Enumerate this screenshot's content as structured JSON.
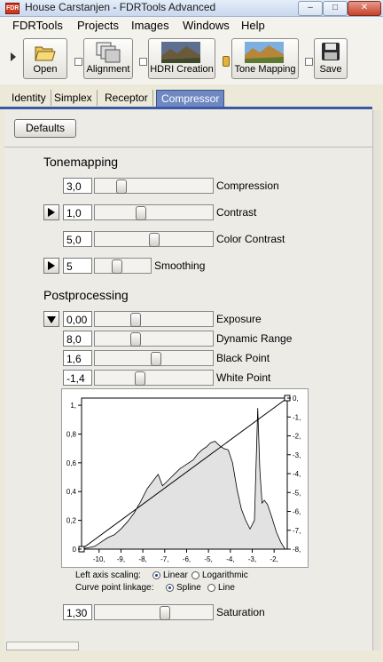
{
  "window": {
    "title": "House Carstanjen - FDRTools Advanced",
    "minimize_label": "–",
    "maximize_label": "□",
    "close_label": "✕",
    "icon_text": "FDR"
  },
  "menu": [
    {
      "label": "FDRTools"
    },
    {
      "label": "Projects"
    },
    {
      "label": "Images"
    },
    {
      "label": "Windows"
    },
    {
      "label": "Help"
    }
  ],
  "toolbar": {
    "open": "Open",
    "alignment": "Alignment",
    "hdri_creation": "HDRI Creation",
    "tone_mapping": "Tone Mapping",
    "save": "Save"
  },
  "tabs": [
    "Identity",
    "Simplex",
    "Receptor",
    "Compressor"
  ],
  "defaults_button": "Defaults",
  "tonemapping": {
    "heading": "Tonemapping",
    "compression": {
      "label": "Compression",
      "value": "3,0",
      "slider": 0.2
    },
    "contrast": {
      "label": "Contrast",
      "value": "1,0",
      "slider": 0.38
    },
    "color_contrast": {
      "label": "Color Contrast",
      "value": "5,0",
      "slider": 0.5
    },
    "smoothing": {
      "label": "Smoothing",
      "value": "5",
      "slider": 0.38
    }
  },
  "postprocessing": {
    "heading": "Postprocessing",
    "exposure": {
      "label": "Exposure",
      "value": "0,00",
      "slider": 0.33
    },
    "dynamic_range": {
      "label": "Dynamic Range",
      "value": "8,0",
      "slider": 0.33
    },
    "black_point": {
      "label": "Black Point",
      "value": "1,6",
      "slider": 0.52
    },
    "white_point": {
      "label": "White Point",
      "value": "-1,4",
      "slider": 0.37
    }
  },
  "chart_data": {
    "type": "line",
    "x_ticks": [
      "-10,",
      "-9,",
      "-8,",
      "-7,",
      "-6,",
      "-5,",
      "-4,",
      "-3,",
      "-2,"
    ],
    "x_tick_values": [
      -10,
      -9,
      -8,
      -7,
      -6,
      -5,
      -4,
      -3,
      -2
    ],
    "left_ticks": [
      "1,",
      "0,8",
      "0,6",
      "0,4",
      "0,2",
      "0"
    ],
    "left_tick_values": [
      1,
      0.8,
      0.6,
      0.4,
      0.2,
      0
    ],
    "right_ticks": [
      "0,",
      "-1,",
      "-2,",
      "-3,",
      "-4,",
      "-5,",
      "-6,",
      "-7,",
      "-8,"
    ],
    "right_tick_values": [
      0,
      -1,
      -2,
      -3,
      -4,
      -5,
      -6,
      -7,
      -8
    ],
    "xlim": [
      -10.8,
      -1.4
    ],
    "ylim": [
      0,
      1.05
    ],
    "histogram": {
      "x": [
        -10.8,
        -10.5,
        -10.2,
        -9.9,
        -9.6,
        -9.3,
        -9.0,
        -8.7,
        -8.4,
        -8.1,
        -7.8,
        -7.5,
        -7.3,
        -7.1,
        -6.9,
        -6.7,
        -6.5,
        -6.3,
        -6.1,
        -5.9,
        -5.7,
        -5.5,
        -5.3,
        -5.1,
        -4.9,
        -4.7,
        -4.5,
        -4.3,
        -4.1,
        -3.9,
        -3.7,
        -3.5,
        -3.3,
        -3.1,
        -2.9,
        -2.75,
        -2.65,
        -2.55,
        -2.45,
        -2.3,
        -2.1,
        -1.9,
        -1.7,
        -1.5
      ],
      "y": [
        0.0,
        0.01,
        0.02,
        0.05,
        0.08,
        0.1,
        0.14,
        0.19,
        0.25,
        0.33,
        0.42,
        0.48,
        0.52,
        0.44,
        0.47,
        0.5,
        0.53,
        0.56,
        0.58,
        0.6,
        0.62,
        0.66,
        0.69,
        0.71,
        0.74,
        0.75,
        0.72,
        0.7,
        0.69,
        0.6,
        0.42,
        0.28,
        0.2,
        0.14,
        0.2,
        0.98,
        0.55,
        0.32,
        0.34,
        0.31,
        0.22,
        0.12,
        0.05,
        0.0
      ]
    },
    "curve": {
      "x": [
        -10.8,
        -1.4
      ],
      "y": [
        0,
        1.05
      ]
    },
    "left_axis_scaling": {
      "label": "Left axis scaling:",
      "options": [
        "Linear",
        "Logarithmic"
      ],
      "selected": "Linear"
    },
    "curve_point_linkage": {
      "label": "Curve point linkage:",
      "options": [
        "Spline",
        "Line"
      ],
      "selected": "Spline"
    }
  },
  "saturation": {
    "label": "Saturation",
    "value": "1,30",
    "slider": 0.6
  },
  "colors": {
    "accent": "#3a5aa8",
    "tab_active": "#6f88c2",
    "histogram_fill": "#e2e2e2"
  }
}
